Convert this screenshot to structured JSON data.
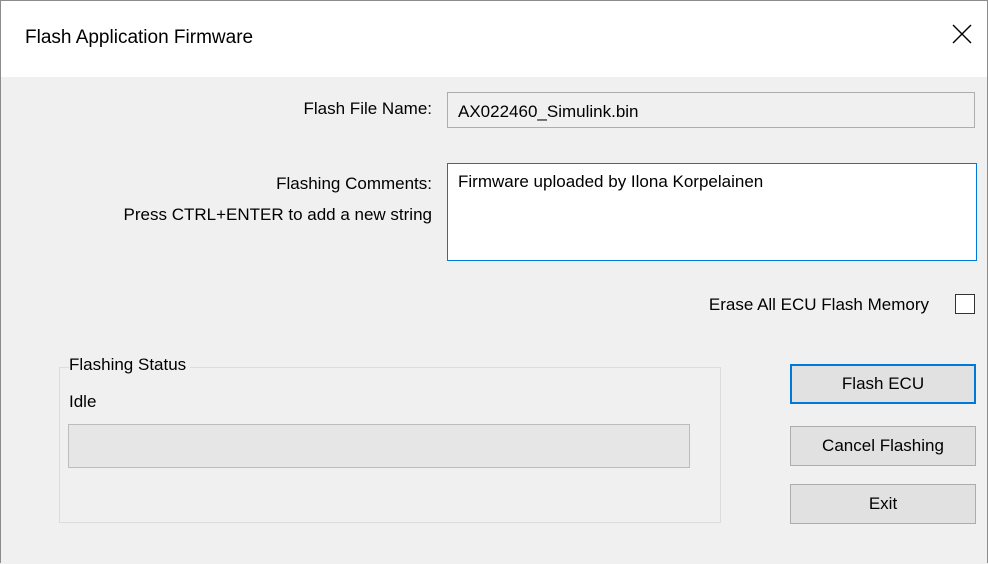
{
  "window": {
    "title": "Flash Application Firmware"
  },
  "form": {
    "flash_file_label": "Flash File Name:",
    "flash_file_value": "AX022460_Simulink.bin",
    "comments_label": "Flashing Comments:",
    "comments_hint": "Press CTRL+ENTER to add a new string",
    "comments_value": "Firmware uploaded by Ilona Korpelainen",
    "erase_label": "Erase All ECU Flash Memory",
    "erase_checked": false
  },
  "status": {
    "group_title": "Flashing Status",
    "state_text": "Idle",
    "progress_fraction": 0
  },
  "buttons": {
    "flash": "Flash ECU",
    "cancel": "Cancel Flashing",
    "exit": "Exit"
  },
  "colors": {
    "accent": "#0078d7",
    "progress_fill": "#06b025"
  }
}
